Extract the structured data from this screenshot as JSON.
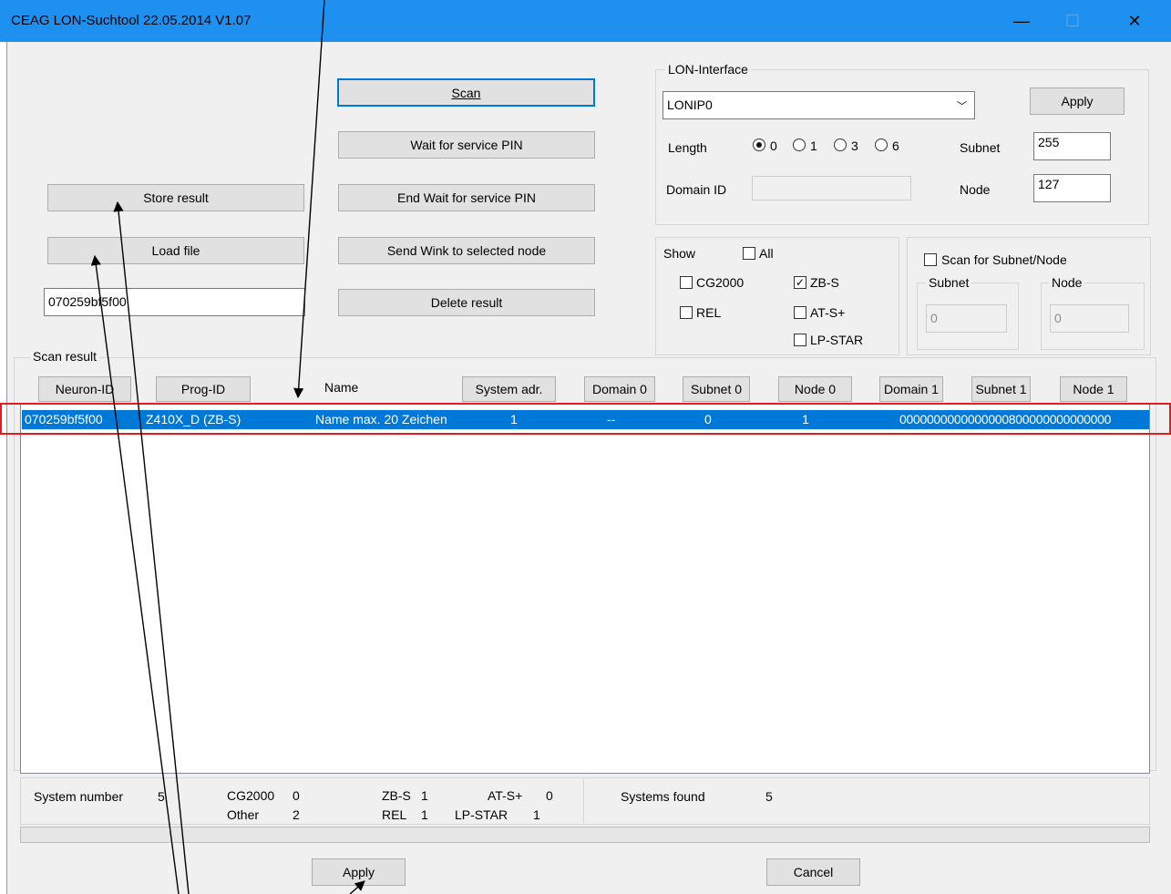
{
  "window": {
    "title": "CEAG LON-Suchtool 22.05.2014 V1.07",
    "minimize_glyph": "—",
    "maximize_glyph": "☐",
    "close_glyph": "✕"
  },
  "actions": {
    "scan": "Scan",
    "wait_service_pin": "Wait for service PIN",
    "end_wait_service_pin": "End Wait for service PIN",
    "send_wink": "Send Wink to selected node",
    "delete_result": "Delete result",
    "store_result": "Store result",
    "load_file": "Load file",
    "neuron_id_value": "070259bf5f00"
  },
  "lon_interface": {
    "legend": "LON-Interface",
    "interface_value": "LONIP0",
    "apply": "Apply",
    "length_label": "Length",
    "length_options": [
      "0",
      "1",
      "3",
      "6"
    ],
    "length_selected": "0",
    "subnet_label": "Subnet",
    "subnet_value": "255",
    "node_label": "Node",
    "node_value": "127",
    "domain_id_label": "Domain ID",
    "domain_id_value": ""
  },
  "show": {
    "label": "Show",
    "all": {
      "label": "All",
      "checked": false
    },
    "cg2000": {
      "label": "CG2000",
      "checked": false
    },
    "zbs": {
      "label": "ZB-S",
      "checked": true
    },
    "rel": {
      "label": "REL",
      "checked": false
    },
    "ats": {
      "label": "AT-S+",
      "checked": false
    },
    "lpstar": {
      "label": "LP-STAR",
      "checked": false
    }
  },
  "scan_subnet_node": {
    "label": "Scan for Subnet/Node",
    "checked": false,
    "subnet_legend": "Subnet",
    "subnet_value": "0",
    "node_legend": "Node",
    "node_value": "0"
  },
  "scan_result": {
    "legend": "Scan result",
    "headers": {
      "neuron_id": "Neuron-ID",
      "prog_id": "Prog-ID",
      "name": "Name",
      "system_adr": "System adr.",
      "domain0": "Domain 0",
      "subnet0": "Subnet 0",
      "node0": "Node 0",
      "domain1": "Domain 1",
      "subnet1": "Subnet 1",
      "node1": "Node 1"
    },
    "rows": [
      {
        "neuron_id": "070259bf5f00",
        "prog_id": "Z410X_D (ZB-S)",
        "name": "Name max. 20 Zeichen",
        "system_adr": "1",
        "domain0": "--",
        "subnet0": "0",
        "node0": "1",
        "domain1": "0000000000000000800000000000000"
      }
    ]
  },
  "status": {
    "system_number_label": "System number",
    "system_number_value": "5",
    "cg2000_label": "CG2000",
    "cg2000_value": "0",
    "other_label": "Other",
    "other_value": "2",
    "zbs_label": "ZB-S",
    "zbs_value": "1",
    "rel_label": "REL",
    "rel_value": "1",
    "ats_label": "AT-S+",
    "ats_value": "0",
    "lpstar_label": "LP-STAR",
    "lpstar_value": "1",
    "systems_found_label": "Systems found",
    "systems_found_value": "5"
  },
  "footer": {
    "apply": "Apply",
    "cancel": "Cancel"
  },
  "colors": {
    "titlebar": "#1e90f0",
    "selection": "#0078d7",
    "annotation_highlight": "#e31c23"
  }
}
